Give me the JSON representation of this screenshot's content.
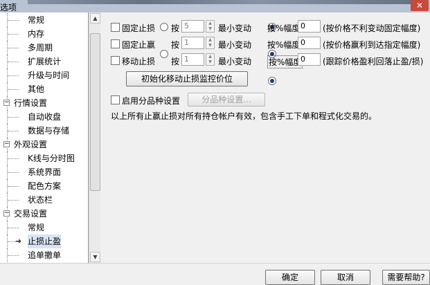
{
  "window": {
    "title": "选项",
    "close_glyph": "✕"
  },
  "tree": {
    "items": [
      {
        "label": "常规",
        "type": "child"
      },
      {
        "label": "内存",
        "type": "child"
      },
      {
        "label": "多周期",
        "type": "child"
      },
      {
        "label": "扩展统计",
        "type": "child"
      },
      {
        "label": "升级与时间",
        "type": "child"
      },
      {
        "label": "其他",
        "type": "child"
      },
      {
        "label": "行情设置",
        "type": "category",
        "toggle": "−"
      },
      {
        "label": "自动收盘",
        "type": "child"
      },
      {
        "label": "数据与存储",
        "type": "child"
      },
      {
        "label": "外观设置",
        "type": "category",
        "toggle": "−"
      },
      {
        "label": "K线与分时图",
        "type": "child"
      },
      {
        "label": "系统界面",
        "type": "child"
      },
      {
        "label": "配色方案",
        "type": "child"
      },
      {
        "label": "状态栏",
        "type": "child"
      },
      {
        "label": "交易设置",
        "type": "category",
        "toggle": "−"
      },
      {
        "label": "常规",
        "type": "child"
      },
      {
        "label": "止损止盈",
        "type": "child",
        "selected": true
      },
      {
        "label": "追单撤单",
        "type": "child"
      }
    ]
  },
  "rows": [
    {
      "check_label": "固定止损",
      "by_label": "按",
      "value": "5",
      "min_label": "最小变动",
      "range_label": "按%幅度",
      "range_value": "0",
      "note": "(按价格不利变动固定幅度)"
    },
    {
      "check_label": "固定止赢",
      "by_label": "按",
      "value": "1",
      "min_label": "最小变动",
      "range_label": "按%幅度",
      "range_value": "0",
      "note": "(按价格赢利到达指定幅度)"
    },
    {
      "check_label": "移动止损",
      "by_label": "按",
      "value": "1",
      "min_label": "最小变动",
      "range_label": "按%幅度",
      "range_value": "0",
      "note": "(跟踪价格盈利回落止盈/损)"
    }
  ],
  "init_button": "初始化移动止损监控价位",
  "variety": {
    "check_label": "启用分品种设置",
    "button": "分品种设置..."
  },
  "note_text": "以上所有止赢止损对所有持仓帐户有效，包含手工下单和程式化交易的。",
  "footer": {
    "ok": "确定",
    "cancel": "取消",
    "help": "需要帮助?"
  }
}
